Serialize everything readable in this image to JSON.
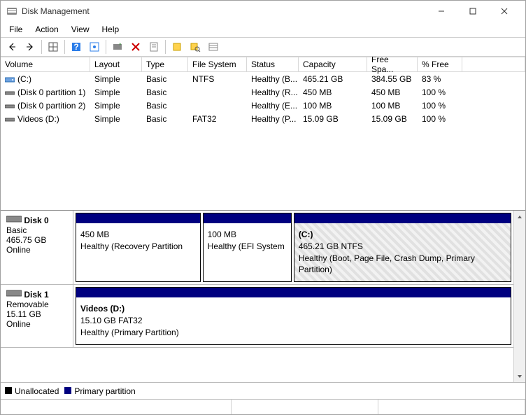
{
  "window": {
    "title": "Disk Management"
  },
  "menu": {
    "file": "File",
    "action": "Action",
    "view": "View",
    "help": "Help"
  },
  "columns": {
    "volume": "Volume",
    "layout": "Layout",
    "type": "Type",
    "fs": "File System",
    "status": "Status",
    "capacity": "Capacity",
    "free": "Free Spa...",
    "pct": "% Free"
  },
  "volumes": [
    {
      "icon": "hdd",
      "name": "(C:)",
      "layout": "Simple",
      "type": "Basic",
      "fs": "NTFS",
      "status": "Healthy (B...",
      "capacity": "465.21 GB",
      "free": "384.55 GB",
      "pct": "83 %"
    },
    {
      "icon": "part",
      "name": "(Disk 0 partition 1)",
      "layout": "Simple",
      "type": "Basic",
      "fs": "",
      "status": "Healthy (R...",
      "capacity": "450 MB",
      "free": "450 MB",
      "pct": "100 %"
    },
    {
      "icon": "part",
      "name": "(Disk 0 partition 2)",
      "layout": "Simple",
      "type": "Basic",
      "fs": "",
      "status": "Healthy (E...",
      "capacity": "100 MB",
      "free": "100 MB",
      "pct": "100 %"
    },
    {
      "icon": "part",
      "name": "Videos (D:)",
      "layout": "Simple",
      "type": "Basic",
      "fs": "FAT32",
      "status": "Healthy (P...",
      "capacity": "15.09 GB",
      "free": "15.09 GB",
      "pct": "100 %"
    }
  ],
  "disks": [
    {
      "label": "Disk 0",
      "type": "Basic",
      "size": "465.75 GB",
      "state": "Online",
      "parts": [
        {
          "title": "",
          "line2": "450 MB",
          "line3": "Healthy (Recovery Partition",
          "flex": 1.2,
          "selected": false
        },
        {
          "title": "",
          "line2": "100 MB",
          "line3": "Healthy (EFI System",
          "flex": 0.85,
          "selected": false
        },
        {
          "title": "(C:)",
          "line2": "465.21 GB NTFS",
          "line3": "Healthy (Boot, Page File, Crash Dump, Primary Partition)",
          "flex": 2.1,
          "selected": true
        }
      ]
    },
    {
      "label": "Disk 1",
      "type": "Removable",
      "size": "15.11 GB",
      "state": "Online",
      "parts": [
        {
          "title": "Videos  (D:)",
          "line2": "15.10 GB FAT32",
          "line3": "Healthy (Primary Partition)",
          "flex": 3,
          "selected": false
        }
      ]
    }
  ],
  "legend": {
    "unalloc": "Unallocated",
    "primary": "Primary partition"
  },
  "colors": {
    "primary": "#000080",
    "unalloc": "#000000"
  }
}
